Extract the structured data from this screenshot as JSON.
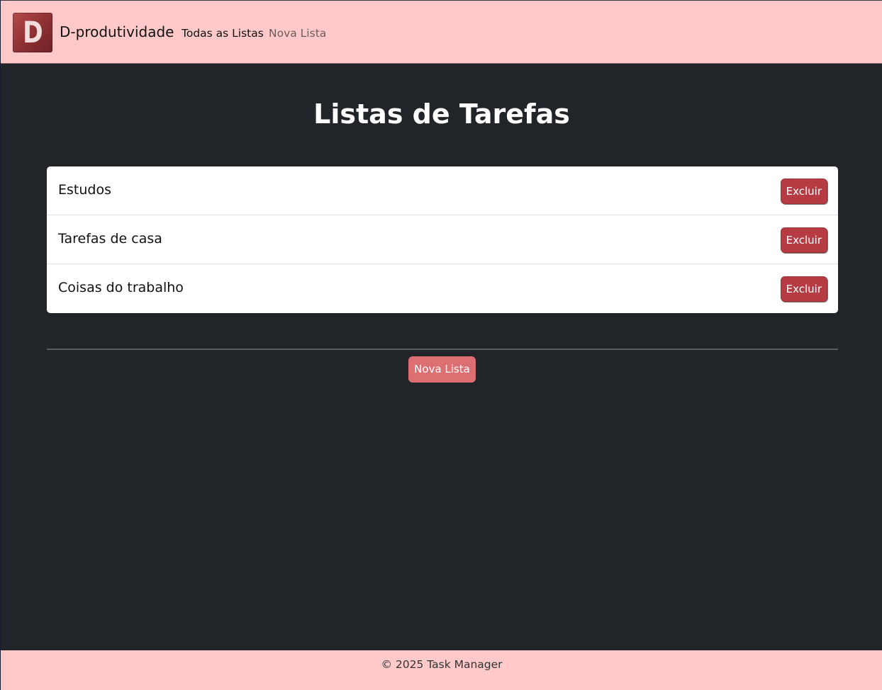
{
  "navbar": {
    "logo_letter": "D",
    "brand": "D-produtividade",
    "links": [
      {
        "label": "Todas as Listas"
      },
      {
        "label": "Nova Lista"
      }
    ]
  },
  "main": {
    "title": "Listas de Tarefas",
    "lists": [
      {
        "name": "Estudos",
        "delete_label": "Excluir"
      },
      {
        "name": "Tarefas de casa",
        "delete_label": "Excluir"
      },
      {
        "name": "Coisas do trabalho",
        "delete_label": "Excluir"
      }
    ],
    "new_list_button": "Nova Lista"
  },
  "footer": {
    "text": "© 2025 Task Manager"
  },
  "colors": {
    "navbar_bg": "#ffc9c9",
    "page_bg": "#212429",
    "delete_button": "#b63b42",
    "new_list_button": "#dd6f73"
  }
}
